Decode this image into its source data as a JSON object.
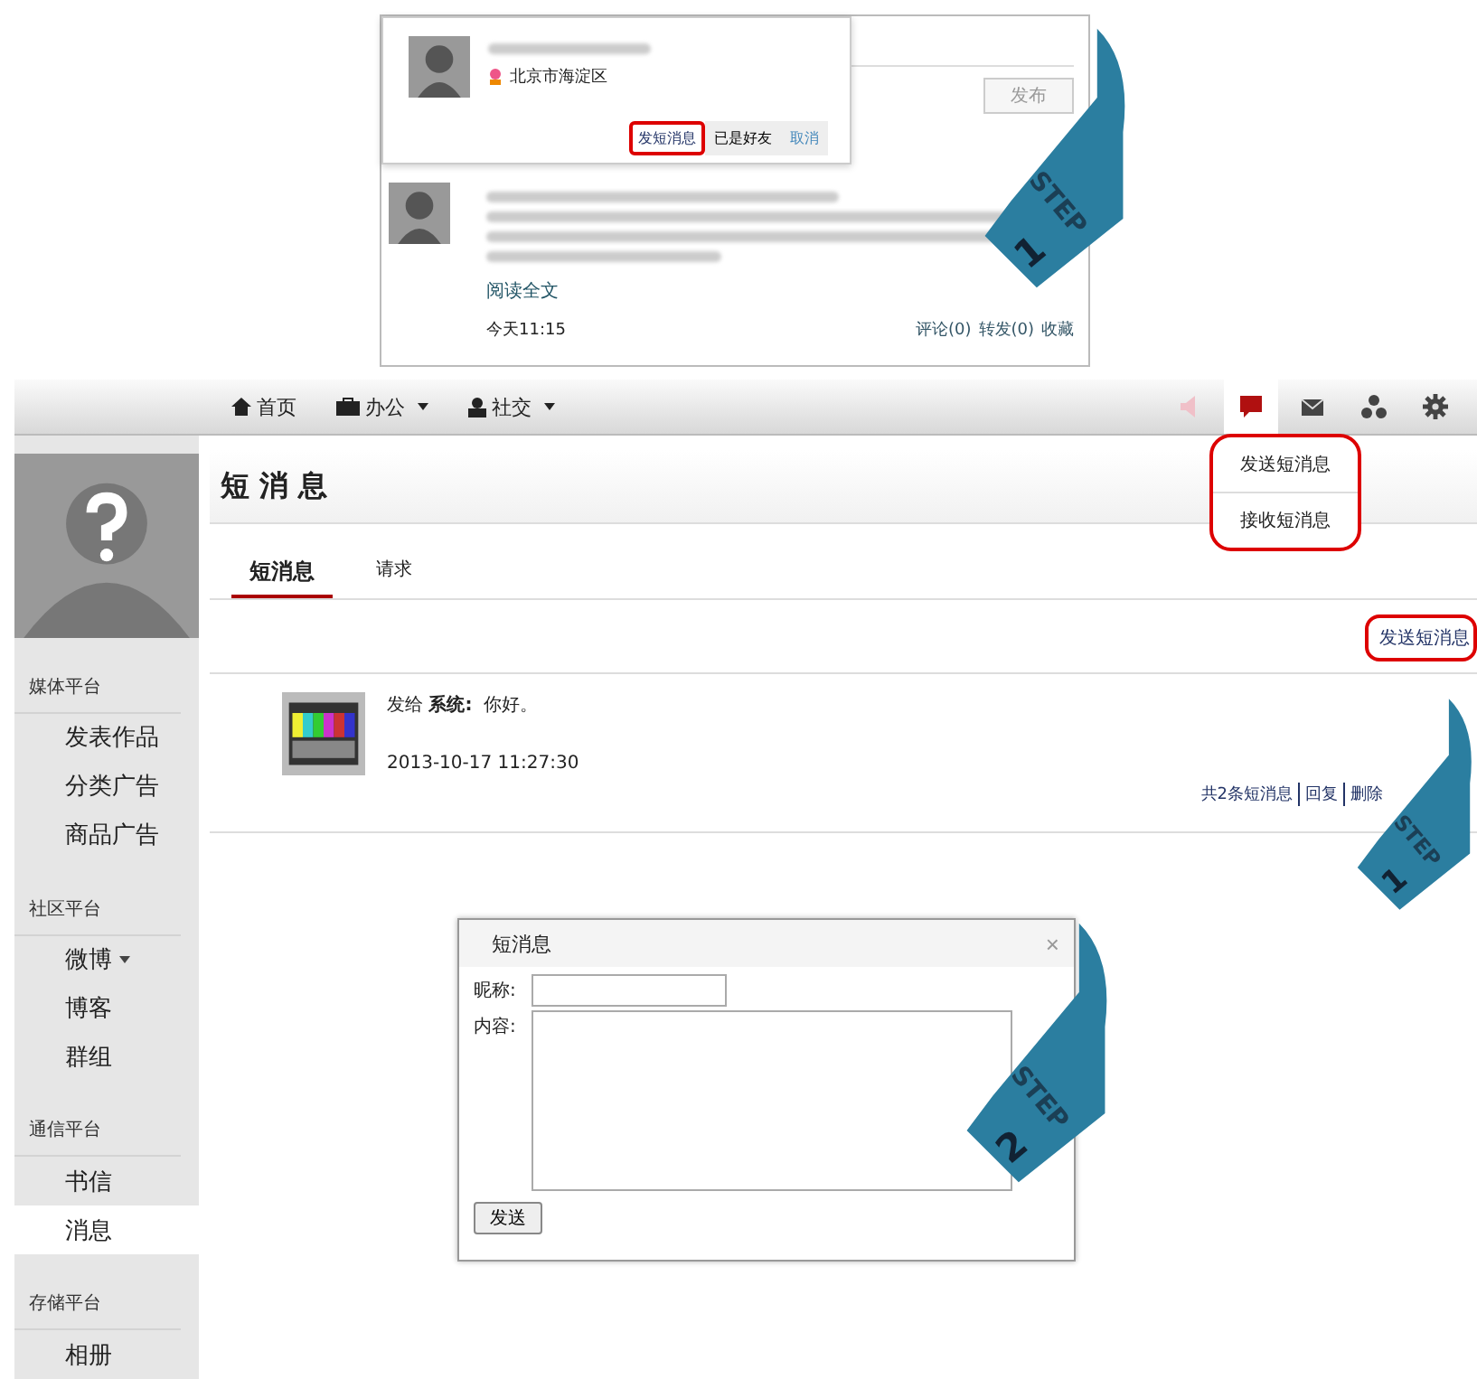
{
  "inset": {
    "location": "北京市海淀区",
    "buttons": [
      {
        "label": "发短消息",
        "highlighted": true
      },
      {
        "label": "已是好友",
        "highlighted": false
      },
      {
        "label": "取消",
        "highlighted": false
      }
    ],
    "publish_button": "发布",
    "read_more": "阅读全文",
    "time": "今天11:15",
    "actions": [
      "评论(0)",
      "转发(0)",
      "收藏"
    ],
    "step": {
      "label": "STEP",
      "number": "1"
    }
  },
  "nav": {
    "items": [
      {
        "label": "首页",
        "dropdown": false
      },
      {
        "label": "办公",
        "dropdown": true
      },
      {
        "label": "社交",
        "dropdown": true
      }
    ],
    "menu": {
      "highlighted": true,
      "items": [
        "发送短消息",
        "接收短消息"
      ]
    }
  },
  "page_title": "短 消 息",
  "tabs": [
    {
      "label": "短消息",
      "selected": true
    },
    {
      "label": "请求",
      "selected": false
    }
  ],
  "send_link": {
    "label": "发送短消息",
    "highlighted": true
  },
  "message": {
    "prefix": "发给",
    "recipient": "系统:",
    "text": "你好。",
    "time": "2013-10-17 11:27:30"
  },
  "footer_links": [
    "共2条短消息",
    "回复",
    "删除"
  ],
  "sidebar": [
    {
      "title": "媒体平台",
      "items": [
        {
          "label": "发表作品",
          "selected": false,
          "dropdown": false
        },
        {
          "label": "分类广告",
          "selected": false,
          "dropdown": false
        },
        {
          "label": "商品广告",
          "selected": false,
          "dropdown": false
        }
      ]
    },
    {
      "title": "社区平台",
      "items": [
        {
          "label": "微博",
          "selected": false,
          "dropdown": true
        },
        {
          "label": "博客",
          "selected": false,
          "dropdown": false
        },
        {
          "label": "群组",
          "selected": false,
          "dropdown": false
        }
      ]
    },
    {
      "title": "通信平台",
      "items": [
        {
          "label": "书信",
          "selected": false,
          "dropdown": false
        },
        {
          "label": "消息",
          "selected": true,
          "dropdown": false
        }
      ]
    },
    {
      "title": "存储平台",
      "items": [
        {
          "label": "相册",
          "selected": false,
          "dropdown": false
        }
      ]
    }
  ],
  "dialog": {
    "title": "短消息",
    "close": "×",
    "fields": [
      {
        "label": "昵称:",
        "kind": "input"
      },
      {
        "label": "内容:",
        "kind": "textarea"
      }
    ],
    "submit": "发送"
  },
  "steps": [
    {
      "label": "STEP",
      "number": "1"
    },
    {
      "label": "STEP",
      "number": "2"
    }
  ]
}
